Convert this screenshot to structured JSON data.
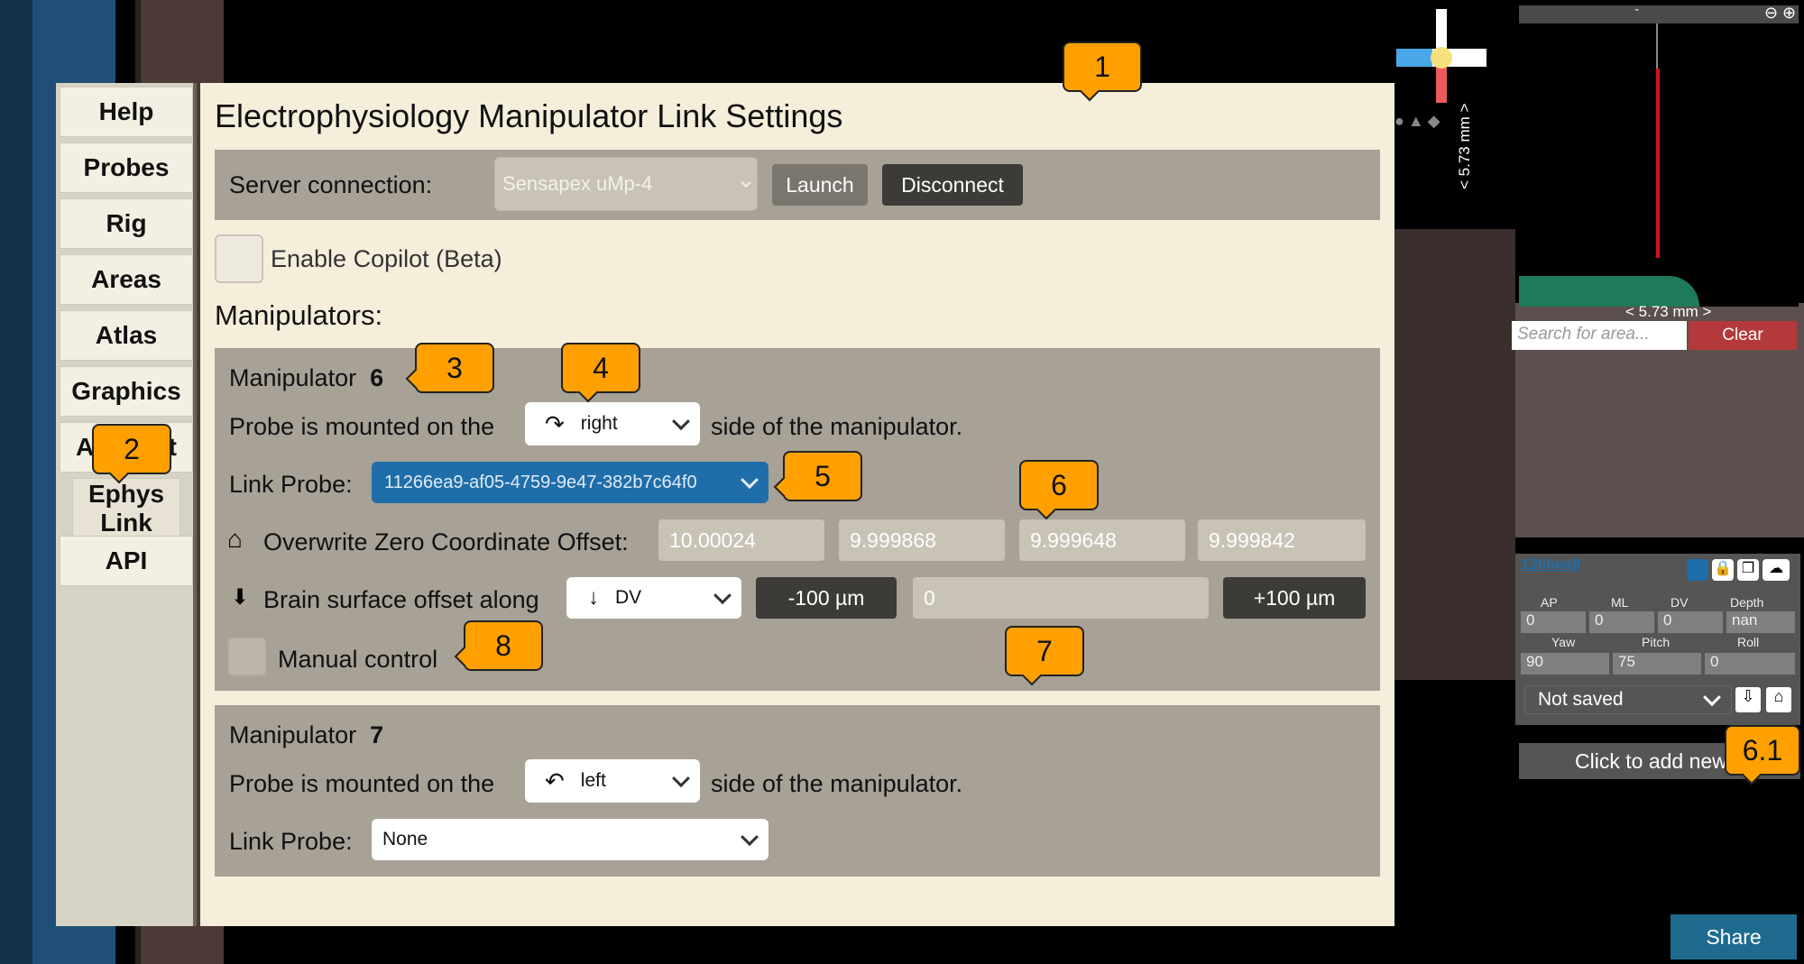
{
  "nav": {
    "items": [
      {
        "label": "Help"
      },
      {
        "label": "Probes"
      },
      {
        "label": "Rig"
      },
      {
        "label": "Areas"
      },
      {
        "label": "Atlas"
      },
      {
        "label": "Graphics"
      },
      {
        "label": "Account"
      },
      {
        "label": "Ephys Link"
      },
      {
        "label": "API"
      }
    ]
  },
  "panel": {
    "title": "Electrophysiology Manipulator Link Settings",
    "server": {
      "label": "Server connection:",
      "selected": "Sensapex uMp-4",
      "launch_label": "Launch",
      "disconnect_label": "Disconnect"
    },
    "copilot_label": "Enable Copilot (Beta)",
    "manipulators_heading": "Manipulators:",
    "manipulator_6": {
      "label": "Manipulator",
      "id": "6",
      "mounted_prefix": "Probe is mounted on the",
      "side": "right",
      "mounted_suffix": "side of the manipulator.",
      "link_label": "Link Probe:",
      "link_value": "11266ea9-af05-4759-9e47-382b7c64f0",
      "zero_label": "Overwrite Zero Coordinate Offset:",
      "zero_values": [
        "10.00024",
        "9.999868",
        "9.999648",
        "9.999842"
      ],
      "brain_label": "Brain surface offset along",
      "axis": "DV",
      "minus_label": "-100 µm",
      "offset_value": "0",
      "plus_label": "+100 µm",
      "manual_label": "Manual control"
    },
    "manipulator_7": {
      "label": "Manipulator",
      "id": "7",
      "mounted_prefix": "Probe is mounted on the",
      "side": "left",
      "mounted_suffix": "side of the manipulator.",
      "link_label": "Link Probe:",
      "link_value": "None"
    }
  },
  "callouts": {
    "c1": "1",
    "c2": "2",
    "c3": "3",
    "c4": "4",
    "c5": "5",
    "c6": "6",
    "c7": "7",
    "c8": "8",
    "c61": "6.1"
  },
  "right": {
    "scale_top": "-",
    "scale_vertical": "< 5.73 mm >",
    "scale_horizontal": "< 5.73 mm >",
    "search_placeholder": "Search for area...",
    "clear_label": "Clear",
    "probe_name": "1266ea9",
    "coord_labels": [
      "AP",
      "ML",
      "DV",
      "Depth"
    ],
    "coord_values": [
      "0",
      "0",
      "0",
      "nan"
    ],
    "angle_labels": [
      "Yaw",
      "Pitch",
      "Roll"
    ],
    "angle_values": [
      "90",
      "75",
      "0"
    ],
    "save_state": "Not saved",
    "add_probe": "Click to add new p",
    "share_label": "Share"
  },
  "colors": {
    "panel_bg": "#f4eedb",
    "section_bg": "#a7a196",
    "callout": "#ffa000",
    "link_probe_selected": "#1f6ea9",
    "clear_button": "#b3393b",
    "share_button": "#1f6b8f"
  }
}
